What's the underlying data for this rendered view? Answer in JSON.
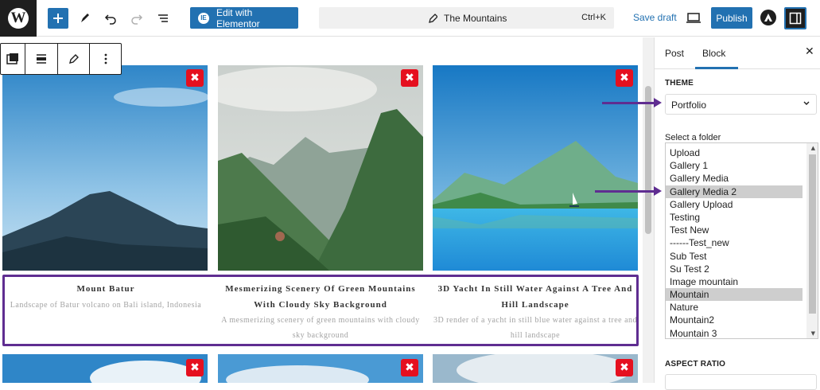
{
  "topbar": {
    "edit_elementor_label": "Edit with Elementor",
    "elementor_icon_text": "IE",
    "command_title": "The Mountains",
    "command_shortcut": "Ctrl+K",
    "save_draft_label": "Save draft",
    "publish_label": "Publish"
  },
  "gallery": {
    "items": [
      {
        "title": "Mount Batur",
        "description": "Landscape of Batur volcano on Bali island, Indonesia"
      },
      {
        "title": "Mesmerizing Scenery Of Green Mountains With Cloudy Sky Background",
        "description": "A mesmerizing scenery of green mountains with cloudy sky background"
      },
      {
        "title": "3D Yacht In Still Water Against A Tree And Hill Landscape",
        "description": "3D render of a yacht in still blue water against a tree and hill landscape"
      }
    ],
    "delete_glyph": "✖",
    "highlight_color": "#5f2d91",
    "delete_color": "#e5101f"
  },
  "sidebar": {
    "tabs": [
      "Post",
      "Block"
    ],
    "active_tab": "Block",
    "close_glyph": "✕",
    "theme_heading": "THEME",
    "theme_value": "Portfolio",
    "folder_label": "Select a folder",
    "folders": [
      "Upload",
      "Gallery 1",
      "Gallery Media",
      "Gallery Media 2",
      "Gallery Upload",
      "Testing",
      "Test New",
      "------Test_new",
      "Sub Test",
      "Su Test 2",
      "Image mountain",
      "Mountain",
      "Nature",
      "Mountain2",
      "Mountain 3"
    ],
    "highlighted_folders": [
      "Gallery Media 2",
      "Mountain"
    ],
    "aspect_ratio_heading": "ASPECT RATIO"
  },
  "colors": {
    "accent": "#2271b1",
    "annotation": "#5f2d91"
  }
}
